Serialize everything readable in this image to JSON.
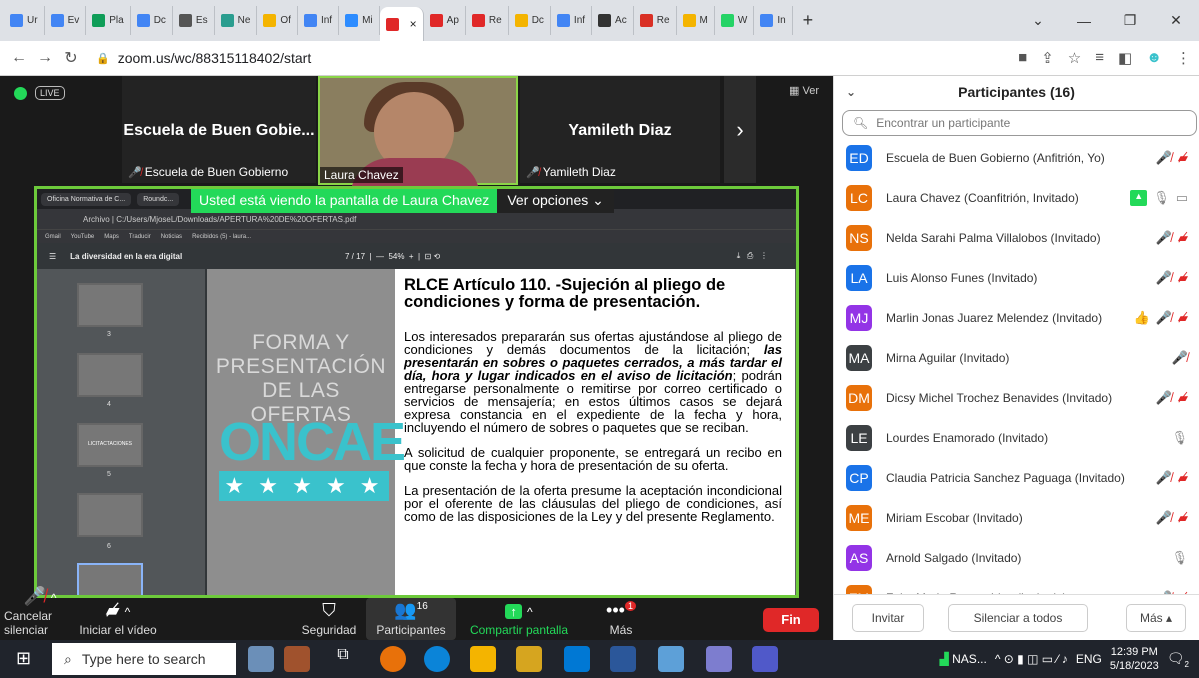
{
  "browser": {
    "tabs": [
      {
        "label": "Ur",
        "color": "#4285f4"
      },
      {
        "label": "Ev",
        "color": "#4285f4"
      },
      {
        "label": "Pla",
        "color": "#0f9d58"
      },
      {
        "label": "Dc",
        "color": "#4285f4"
      },
      {
        "label": "Es",
        "color": "#555555"
      },
      {
        "label": "Ne",
        "color": "#2a9d8f"
      },
      {
        "label": "Of",
        "color": "#f4b400"
      },
      {
        "label": "Inf",
        "color": "#4285f4"
      },
      {
        "label": "Mi",
        "color": "#2d8cff"
      },
      {
        "label": "",
        "color": "#e02828",
        "active": true
      },
      {
        "label": "Ap",
        "color": "#e02828"
      },
      {
        "label": "Re",
        "color": "#e02828"
      },
      {
        "label": "Dc",
        "color": "#f4b400"
      },
      {
        "label": "Inf",
        "color": "#4285f4"
      },
      {
        "label": "Ac",
        "color": "#333333"
      },
      {
        "label": "Re",
        "color": "#d93025"
      },
      {
        "label": "M",
        "color": "#f4b400"
      },
      {
        "label": "W",
        "color": "#25d366"
      },
      {
        "label": "In",
        "color": "#4285f4"
      }
    ],
    "url": "zoom.us/wc/88315118402/start"
  },
  "meeting": {
    "live_badge": "LIVE",
    "ver_label": "Ver",
    "tiles": [
      {
        "big": "Escuela de Buen Gobie...",
        "small": "Escuela de Buen Gobierno"
      },
      {
        "small": "Laura Chavez",
        "video": true
      },
      {
        "big": "Yamileth Diaz",
        "small": "Yamileth Diaz"
      }
    ],
    "share_banner": "Usted está viendo la pantalla de Laura Chavez",
    "view_options": "Ver opciones"
  },
  "shared": {
    "inner_tabs": [
      "Oficina Normativa de C...",
      "Roundc..."
    ],
    "inner_url": "Archivo | C:/Users/MjoseL/Downloads/APERTURA%20DE%20OFERTAS.pdf",
    "bookmarks": [
      "Gmail",
      "YouTube",
      "Maps",
      "Traducir",
      "Noticias",
      "Recibidos (5) - laura..."
    ],
    "pdf_title": "La diversidad en la era digital",
    "page_indicator": "7 / 17",
    "zoom": "54%",
    "thumb_numbers": [
      "3",
      "4",
      "5",
      "6"
    ],
    "thumb_label": "LICITACTACIONES",
    "left_title": "FORMA Y PRESENTACIÓN DE LAS OFERTAS",
    "logo_text": "ONCAE",
    "logo_stars": "★ ★ ★ ★ ★",
    "heading": "RLCE Artículo 110. -Sujeción al pliego de condiciones y forma de presentación.",
    "para1_a": "Los interesados prepararán sus ofertas ajustándose al pliego de condiciones y demás documentos de la licitación; ",
    "para1_b": "las presentarán en sobres o paquetes cerrados, a más tardar el día, hora y lugar indicados en el aviso de licitación",
    "para1_c": "; podrán entregarse personalmente o remitirse por correo certificado o servicios de mensajería; en estos últimos casos se dejará expresa constancia en el expediente de la fecha y hora, incluyendo el número de sobres o paquetes que se reciban.",
    "para2": "A solicitud de cualquier proponente, se entregará un recibo en que conste la fecha y hora de presentación de su oferta.",
    "para3": "La presentación de la oferta presume la aceptación incondicional por el oferente de las cláusulas del pliego de condiciones, así como de las disposiciones de la Ley y del presente Reglamento."
  },
  "toolbar": {
    "unmute": "Cancelar silenciar",
    "start_video": "Iniciar el vídeo",
    "security": "Seguridad",
    "participants": "Participantes",
    "participants_count": "16",
    "share": "Compartir pantalla",
    "more": "Más",
    "more_badge": "1",
    "end": "Fin"
  },
  "panel": {
    "title": "Participantes (16)",
    "search_placeholder": "Encontrar un participante",
    "participants": [
      {
        "initials": "ED",
        "name": "Escuela de Buen Gobierno (Anfitrión, Yo)",
        "color": "#1a73e8",
        "icons": [
          "mic-off",
          "video-off"
        ]
      },
      {
        "initials": "LC",
        "name": "Laura Chavez (Coanfitrión, Invitado)",
        "color": "#e8710a",
        "icons": [
          "share",
          "mic",
          "video"
        ]
      },
      {
        "initials": "NS",
        "name": "Nelda Sarahi Palma Villalobos (Invitado)",
        "color": "#e8710a",
        "icons": [
          "mic-off",
          "video-off"
        ]
      },
      {
        "initials": "LA",
        "name": "Luis Alonso Funes (Invitado)",
        "color": "#1a73e8",
        "icons": [
          "mic-off",
          "video-off"
        ]
      },
      {
        "initials": "MJ",
        "name": "Marlin Jonas Juarez Melendez (Invitado)",
        "color": "#9334e6",
        "icons": [
          "thumb",
          "mic-off",
          "video-off"
        ]
      },
      {
        "initials": "MA",
        "name": "Mirna Aguilar (Invitado)",
        "color": "#3c4043",
        "icons": [
          "mic-off"
        ]
      },
      {
        "initials": "DM",
        "name": "Dicsy Michel Trochez Benavides (Invitado)",
        "color": "#e8710a",
        "icons": [
          "mic-off",
          "video-off"
        ]
      },
      {
        "initials": "LE",
        "name": "Lourdes Enamorado (Invitado)",
        "color": "#3c4043",
        "icons": [
          "mic"
        ]
      },
      {
        "initials": "CP",
        "name": "Claudia Patricia Sanchez Paguaga (Invitado)",
        "color": "#1a73e8",
        "icons": [
          "mic-off",
          "video-off"
        ]
      },
      {
        "initials": "ME",
        "name": "Miriam Escobar (Invitado)",
        "color": "#e8710a",
        "icons": [
          "mic-off",
          "video-off"
        ]
      },
      {
        "initials": "AS",
        "name": "Arnold Salgado (Invitado)",
        "color": "#9334e6",
        "icons": [
          "mic"
        ]
      },
      {
        "initials": "FM",
        "name": "Faby Maria Ramos Irias (Invitado)",
        "color": "#e8710a",
        "icons": [
          "mic-off",
          "video-off"
        ]
      }
    ],
    "invite": "Invitar",
    "mute_all": "Silenciar a todos",
    "more": "Más"
  },
  "taskbar": {
    "search_placeholder": "Type here to search",
    "network": "NAS...",
    "lang": "ENG",
    "time": "12:39 PM",
    "date": "5/18/2023",
    "notif_count": "2"
  }
}
